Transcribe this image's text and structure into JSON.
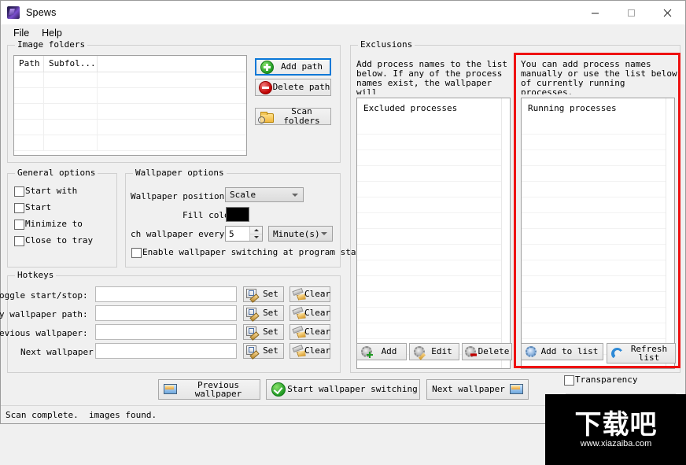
{
  "window": {
    "title": "Spews",
    "icon": "app-icon",
    "controls": {
      "minimize": "minimize-icon",
      "maximize": "maximize-icon",
      "close": "close-icon"
    }
  },
  "menubar": {
    "items": [
      {
        "label": "File"
      },
      {
        "label": "Help"
      }
    ]
  },
  "image_folders": {
    "legend": "Image folders",
    "table": {
      "columns": [
        "Path",
        "Subfol...",
        ""
      ],
      "rows": []
    },
    "buttons": {
      "add_path": "Add path",
      "delete_path": "Delete path",
      "scan_folders": "Scan folders"
    }
  },
  "general_options": {
    "legend": "General options",
    "checkboxes": [
      {
        "label": "Start with\nWindows",
        "checked": false
      },
      {
        "label": "Start\nminimized",
        "checked": false
      },
      {
        "label": "Minimize to\ntray",
        "checked": false
      },
      {
        "label": "Close to tray",
        "checked": false
      }
    ]
  },
  "wallpaper_options": {
    "legend": "Wallpaper options",
    "position_label": "Wallpaper position:",
    "position_value": "Scale",
    "fill_color_label": "Fill color:",
    "fill_color_value": "#000000",
    "interval_label": "ch wallpaper every:",
    "interval_value": "5",
    "interval_unit": "Minute(s)",
    "enable_startup_label": "Enable wallpaper switching at program startup",
    "enable_startup_checked": false
  },
  "hotkeys": {
    "legend": "Hotkeys",
    "rows": [
      {
        "label": "oggle start/stop:",
        "value": "",
        "set": "Set",
        "clear": "Clear"
      },
      {
        "label": "y wallpaper path:",
        "value": "",
        "set": "Set",
        "clear": "Clear"
      },
      {
        "label": "evious wallpaper:",
        "value": "",
        "set": "Set",
        "clear": "Clear"
      },
      {
        "label": "Next wallpaper:",
        "value": "",
        "set": "Set",
        "clear": "Clear"
      }
    ]
  },
  "exclusions": {
    "legend": "Exclusions",
    "left": {
      "description": "Add process names to the list\nbelow.  If any of the process\nnames exist, the wallpaper will\nnot be changed.",
      "list_caption": "Excluded processes",
      "buttons": {
        "add": "Add",
        "edit": "Edit",
        "delete": "Delete"
      }
    },
    "right": {
      "description": "You can add process names\nmanually or use the list below\nof currently running processes.",
      "list_caption": "Running processes",
      "buttons": {
        "add_to_list": "Add to list",
        "refresh_list": "Refresh\nlist"
      }
    },
    "highlight_color": "#ee1111"
  },
  "bottom_bar": {
    "previous_wallpaper": "Previous\nwallpaper",
    "start_switching": "Start wallpaper switching",
    "next_wallpaper": "Next wallpaper",
    "transparency_label": "Transparency",
    "transparency_checked": false
  },
  "statusbar": {
    "left": "Scan complete.",
    "right": "images found."
  },
  "watermark": {
    "text_cn": "下载吧",
    "url": "www.xiazaiba.com"
  }
}
